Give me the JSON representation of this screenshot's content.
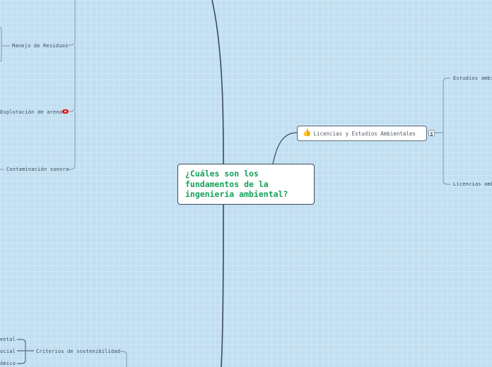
{
  "central": {
    "line1": "¿Cuáles son los",
    "line2": "fundamentos de la",
    "line3": "ingeniería ambiental?"
  },
  "topics": {
    "licencias": {
      "label": "Licencias y Estudios Ambientales",
      "icon": "thumbs-up-icon",
      "children": [
        "Estudios ambi",
        "Licencias amb"
      ]
    }
  },
  "left_branches": {
    "manejo": "Manejo de Residuos",
    "explotacion": "Explotación de arena",
    "contaminacion": "Contaminación sonora",
    "criterios": "Criterios de sostenibilidad",
    "criterios_children": [
      "ental",
      "ocial",
      "ómico"
    ]
  },
  "colors": {
    "background": "#c2dff2",
    "main_line": "#3b4a5a",
    "central_text": "#16a05a",
    "badge": "#e01818"
  }
}
